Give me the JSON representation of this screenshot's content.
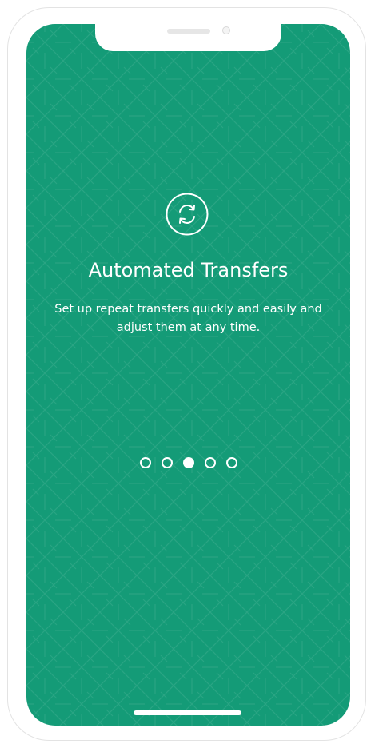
{
  "onboarding": {
    "title": "Automated Transfers",
    "description": "Set up repeat transfers quickly and easily and adjust them at any time.",
    "icon": "repeat-transfer-icon",
    "pager": {
      "total": 5,
      "active_index": 2
    }
  },
  "colors": {
    "background": "#149b77",
    "foreground": "#ffffff",
    "device_frame": "#ffffff"
  }
}
